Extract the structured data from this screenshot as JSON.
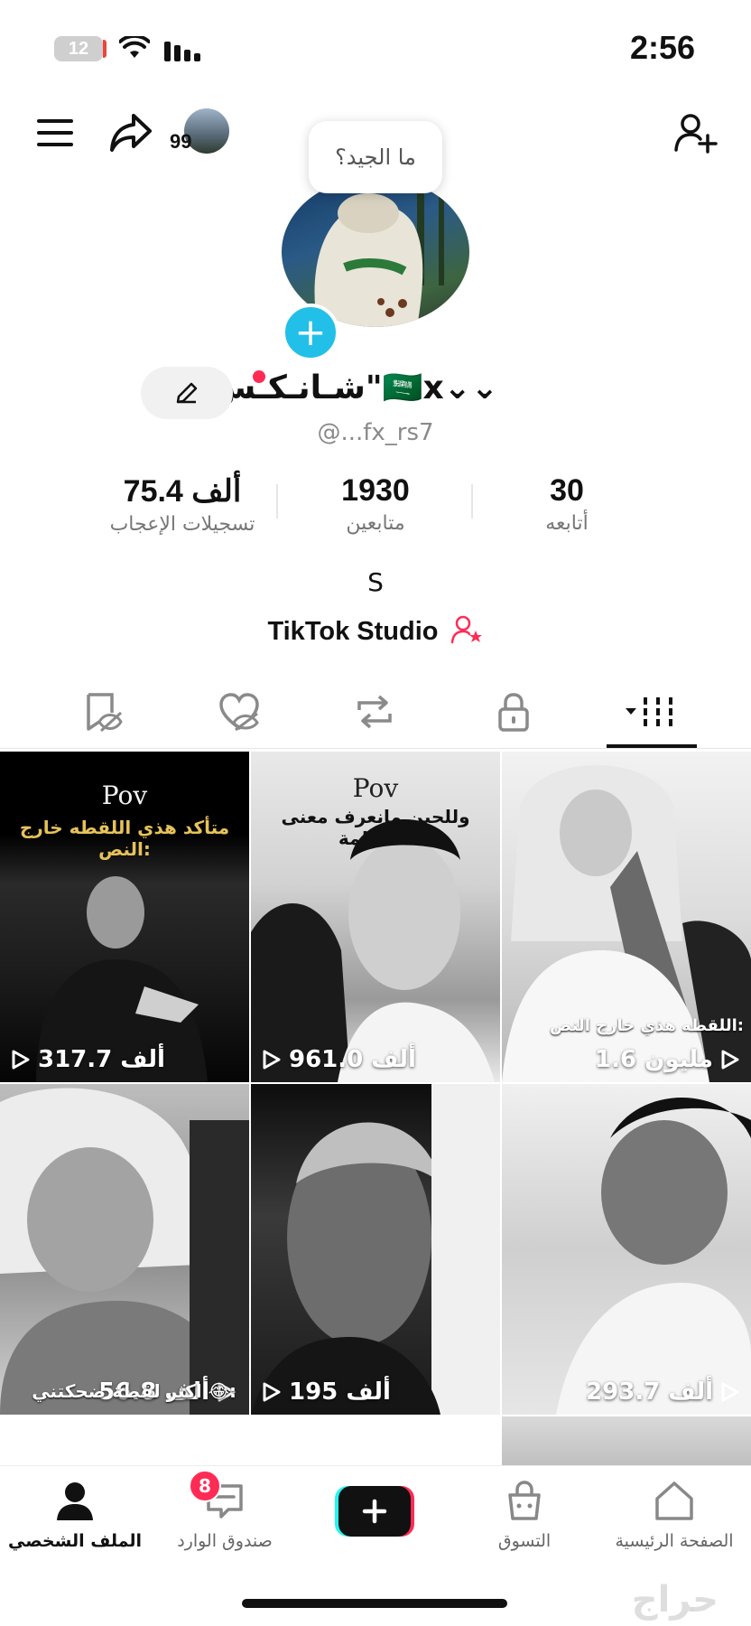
{
  "status_bar": {
    "time": "2:56",
    "battery": "12"
  },
  "header": {
    "story_count": "99"
  },
  "tooltip": {
    "text": "ما الجيد؟"
  },
  "profile": {
    "name": "شـانـكـس\"🇸🇦x⌄⌄",
    "handle": "@...fx_rs7",
    "bio": "S",
    "studio_label": "TikTok Studio"
  },
  "stats": [
    {
      "value": "75.4 ألف",
      "label": "تسجيلات الإعجاب"
    },
    {
      "value": "1930",
      "label": "متابعين"
    },
    {
      "value": "30",
      "label": "أتابعه"
    }
  ],
  "tabs": [
    {
      "name": "liked-hidden",
      "icon": "eye-slash-icon"
    },
    {
      "name": "favorites",
      "icon": "heart-slash-icon"
    },
    {
      "name": "reposts",
      "icon": "repost-icon"
    },
    {
      "name": "private",
      "icon": "lock-icon"
    },
    {
      "name": "videos",
      "icon": "grid-icon",
      "selected": true
    }
  ],
  "videos": [
    {
      "views": "317.7 ألف",
      "caption_top": "Pov",
      "caption_sub": "متأكد هذي اللقطه خارج النص:"
    },
    {
      "views": "961.0 ألف",
      "caption_top": "Pov",
      "caption_sub": "وللحين مانعرف معنى هالكلمة:"
    },
    {
      "views": "1.6 مليون",
      "caption_low": "اللقطه هذي خارج النص:"
    },
    {
      "views": "56.8 ألف",
      "caption_low": "اكثر لقطة ضحكتني 😂:"
    },
    {
      "views": "195 ألف"
    },
    {
      "views": "293.7 ألف"
    }
  ],
  "bottom_nav": {
    "profile": "الملف الشخصي",
    "inbox": "صندوق الوارد",
    "inbox_badge": "8",
    "shop": "التسوق",
    "home": "الصفحة الرئيسية"
  },
  "watermark": "حراج",
  "colors": {
    "accent": "#fe2c55",
    "cyan": "#25f4ee",
    "plus_badge": "#22c0e8"
  }
}
